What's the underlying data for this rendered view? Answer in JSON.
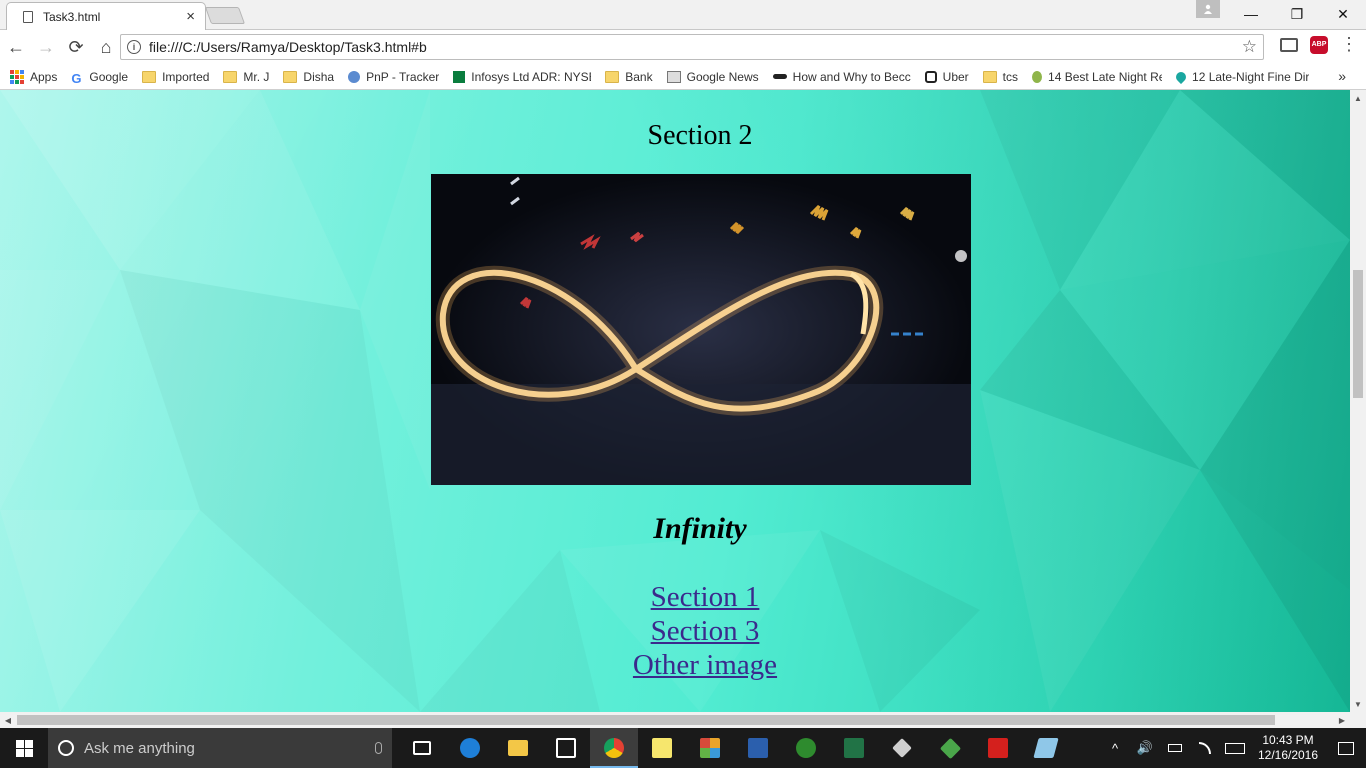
{
  "browser": {
    "tab_title": "Task3.html",
    "tab_close": "×",
    "url": "file:///C:/Users/Ramya/Desktop/Task3.html#b",
    "window_controls": {
      "minimize": "—",
      "maximize": "❐",
      "close": "✕"
    },
    "nav": {
      "back": "←",
      "forward": "→",
      "reload": "⟳",
      "home": "⌂"
    },
    "star": "☆",
    "menu": "⋮",
    "abp_label": "ABP"
  },
  "bookmarks": {
    "items": [
      {
        "label": "Apps",
        "icon": "apps-grid-icon"
      },
      {
        "label": "Google",
        "icon": "google-icon"
      },
      {
        "label": "Imported",
        "icon": "folder-icon"
      },
      {
        "label": "Mr. J",
        "icon": "folder-icon"
      },
      {
        "label": "Disha",
        "icon": "folder-icon"
      },
      {
        "label": "PnP - Tracker",
        "icon": "tata-icon"
      },
      {
        "label": "Infosys Ltd ADR: NYSE",
        "icon": "infosys-icon"
      },
      {
        "label": "Bank",
        "icon": "folder-icon"
      },
      {
        "label": "Google News",
        "icon": "news-icon"
      },
      {
        "label": "How and Why to Becc",
        "icon": "mustache-icon"
      },
      {
        "label": "Uber",
        "icon": "uber-icon"
      },
      {
        "label": "tcs",
        "icon": "folder-icon"
      },
      {
        "label": "14 Best Late Night Re",
        "icon": "award-icon"
      },
      {
        "label": "12 Late-Night Fine Dir",
        "icon": "map-pin-icon"
      }
    ],
    "overflow": "»"
  },
  "page": {
    "section_heading": "Section 2",
    "caption": "Infinity",
    "links": [
      "Section 1 ",
      "Section 3",
      "Other image"
    ]
  },
  "taskbar": {
    "search_placeholder": "Ask me anything",
    "time": "10:43 PM",
    "date": "12/16/2016",
    "tray_arrow": "^",
    "volume": "🔊",
    "icons": [
      {
        "name": "task-view-icon",
        "color": "#ffffff"
      },
      {
        "name": "edge-icon",
        "color": "#1e7fd8"
      },
      {
        "name": "file-explorer-icon",
        "color": "#f3c747"
      },
      {
        "name": "store-icon",
        "color": "#ffffff"
      },
      {
        "name": "chrome-icon",
        "color": "#e34133"
      },
      {
        "name": "sticky-notes-icon",
        "color": "#f6e66d"
      },
      {
        "name": "ms-app-icon",
        "color": "#e9a42b"
      },
      {
        "name": "word-icon",
        "color": "#2b5fad"
      },
      {
        "name": "function-app-icon",
        "color": "#2e8b2e"
      },
      {
        "name": "excel-icon",
        "color": "#217346"
      },
      {
        "name": "pen-app-icon",
        "color": "#cfcfcf"
      },
      {
        "name": "git-icon",
        "color": "#4aa64a"
      },
      {
        "name": "acrobat-icon",
        "color": "#d4201d"
      },
      {
        "name": "notepad-icon",
        "color": "#8fc7e8"
      }
    ]
  }
}
